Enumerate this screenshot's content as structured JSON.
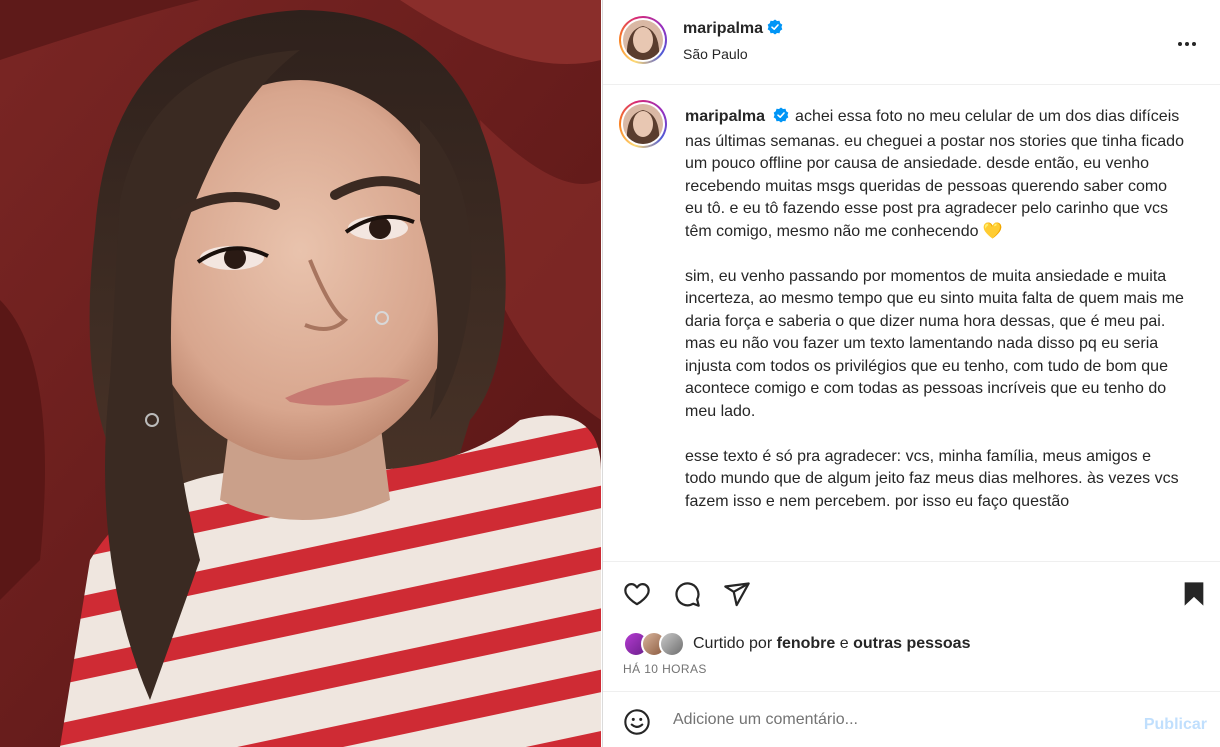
{
  "post": {
    "username": "maripalma",
    "location": "São Paulo",
    "verified": true,
    "image_alt": "selfie photo"
  },
  "caption": {
    "username": "maripalma",
    "text": "achei essa foto no meu celular de um dos dias difíceis nas últimas semanas. eu cheguei a postar nos stories que tinha ficado um pouco offline por causa de ansiedade. desde então, eu venho recebendo muitas msgs queridas de pessoas querendo saber como eu tô. e eu tô fazendo esse post pra agradecer pelo carinho que vcs têm comigo, mesmo não me conhecendo 💛\n\nsim, eu venho passando por momentos de muita ansiedade e muita incerteza, ao mesmo tempo que eu sinto muita falta de quem mais me daria força e saberia o que dizer numa hora dessas, que é meu pai. mas eu não vou fazer um texto lamentando nada disso pq eu seria injusta com todos os privilégios que eu tenho, com tudo de bom que acontece comigo e com todas as pessoas incríveis que eu tenho do meu lado.\n\nesse texto é só pra agradecer: vcs, minha família, meus amigos e todo mundo que de algum jeito faz meus dias melhores. às vezes vcs fazem isso e nem percebem. por isso eu faço questão"
  },
  "likes": {
    "prefix": "Curtido por",
    "user": "fenobre",
    "conjunction": "e",
    "others": "outras pessoas"
  },
  "timestamp": "HÁ 10 HORAS",
  "comment": {
    "placeholder": "Adicione um comentário...",
    "publish_label": "Publicar"
  },
  "icons": {
    "more": "more-horizontal-icon",
    "like": "heart-icon",
    "comment": "comment-icon",
    "share": "share-icon",
    "save": "bookmark-icon",
    "emoji": "emoji-icon",
    "verified": "verified-badge-icon"
  },
  "colors": {
    "verified": "#0095f6",
    "publish_disabled": "#c0dffd",
    "border": "#dbdbdb"
  }
}
